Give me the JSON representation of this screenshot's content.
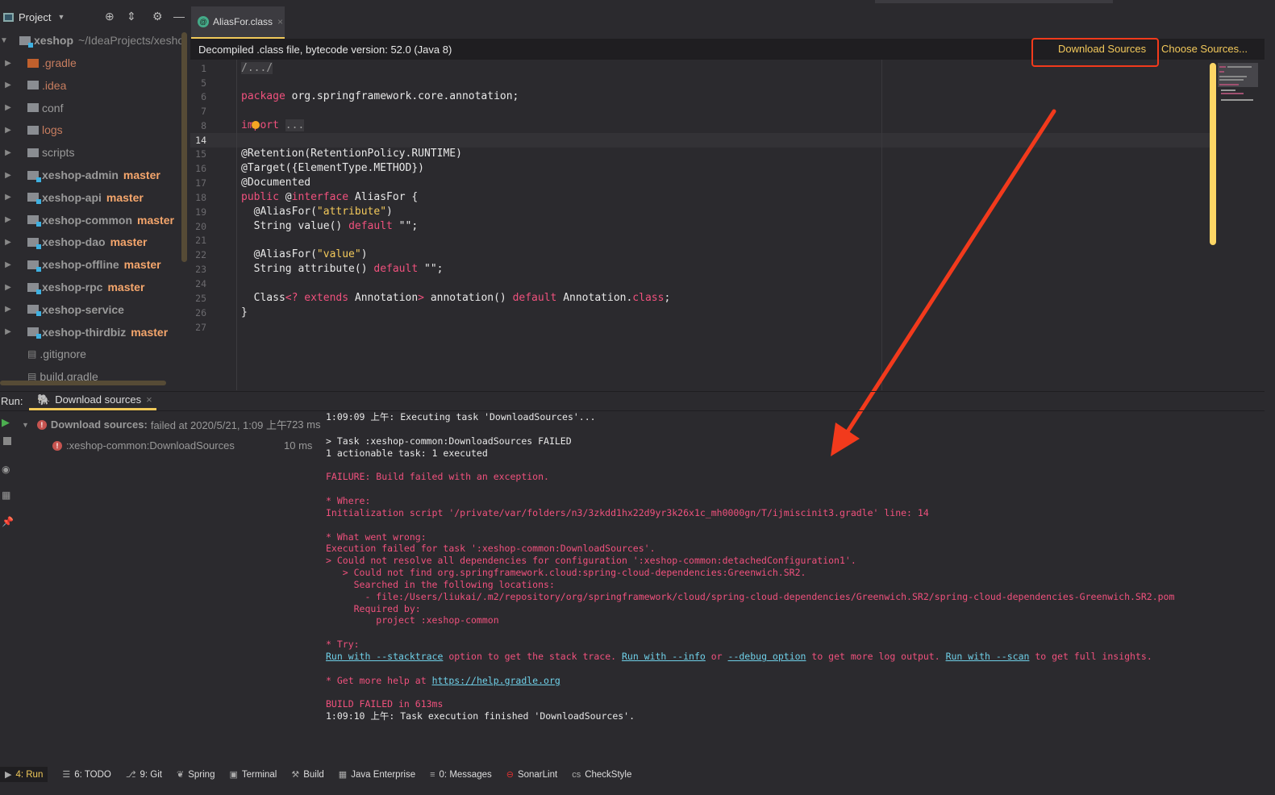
{
  "project_panel": {
    "title": "Project",
    "root": {
      "name": "xeshop",
      "path": "~/IdeaProjects/xesho"
    },
    "items": [
      {
        "name": ".gradle",
        "branch": "",
        "type": "folder-excluded"
      },
      {
        "name": ".idea",
        "branch": "",
        "type": "folder"
      },
      {
        "name": "conf",
        "branch": "",
        "type": "folder"
      },
      {
        "name": "logs",
        "branch": "",
        "type": "folder"
      },
      {
        "name": "scripts",
        "branch": "",
        "type": "folder"
      },
      {
        "name": "xeshop-admin",
        "branch": "master",
        "type": "module"
      },
      {
        "name": "xeshop-api",
        "branch": "master",
        "type": "module"
      },
      {
        "name": "xeshop-common",
        "branch": "master",
        "type": "module"
      },
      {
        "name": "xeshop-dao",
        "branch": "master",
        "type": "module"
      },
      {
        "name": "xeshop-offline",
        "branch": "master",
        "type": "module"
      },
      {
        "name": "xeshop-rpc",
        "branch": "master",
        "type": "module"
      },
      {
        "name": "xeshop-service",
        "branch": "",
        "type": "module"
      },
      {
        "name": "xeshop-thirdbiz",
        "branch": "master",
        "type": "module"
      },
      {
        "name": ".gitignore",
        "branch": "",
        "type": "file"
      },
      {
        "name": "build.gradle",
        "branch": "",
        "type": "file"
      }
    ]
  },
  "editor": {
    "tab": "AliasFor.class",
    "banner": "Decompiled .class file, bytecode version: 52.0 (Java 8)",
    "download_sources": "Download Sources",
    "choose_sources": "Choose Sources...",
    "lines": [
      {
        "n": "1",
        "tokens": [
          {
            "t": "/.../",
            "c": "cm"
          }
        ]
      },
      {
        "n": "5",
        "tokens": []
      },
      {
        "n": "6",
        "tokens": [
          {
            "t": "package",
            "c": "kw"
          },
          {
            "t": " org.springframework.core.annotation;",
            "c": ""
          }
        ]
      },
      {
        "n": "7",
        "tokens": []
      },
      {
        "n": "8",
        "tokens": [
          {
            "t": "import",
            "c": "kw"
          },
          {
            "t": " ",
            "c": ""
          },
          {
            "t": "...",
            "c": "fold"
          }
        ]
      },
      {
        "n": "14",
        "tokens": []
      },
      {
        "n": "15",
        "tokens": [
          {
            "t": "@Retention(RetentionPolicy.RUNTIME)",
            "c": ""
          }
        ]
      },
      {
        "n": "16",
        "tokens": [
          {
            "t": "@Target({ElementType.METHOD})",
            "c": ""
          }
        ]
      },
      {
        "n": "17",
        "tokens": [
          {
            "t": "@Documented",
            "c": ""
          }
        ]
      },
      {
        "n": "18",
        "tokens": [
          {
            "t": "public",
            "c": "kw"
          },
          {
            "t": " @",
            "c": ""
          },
          {
            "t": "interface",
            "c": "kw"
          },
          {
            "t": " AliasFor {",
            "c": ""
          }
        ]
      },
      {
        "n": "19",
        "tokens": [
          {
            "t": "  @AliasFor(",
            "c": ""
          },
          {
            "t": "\"attribute\"",
            "c": "str"
          },
          {
            "t": ")",
            "c": ""
          }
        ]
      },
      {
        "n": "20",
        "tokens": [
          {
            "t": "  String value() ",
            "c": ""
          },
          {
            "t": "default",
            "c": "kw"
          },
          {
            "t": " \"\";",
            "c": ""
          }
        ]
      },
      {
        "n": "21",
        "tokens": []
      },
      {
        "n": "22",
        "tokens": [
          {
            "t": "  @AliasFor(",
            "c": ""
          },
          {
            "t": "\"value\"",
            "c": "str"
          },
          {
            "t": ")",
            "c": ""
          }
        ]
      },
      {
        "n": "23",
        "tokens": [
          {
            "t": "  String attribute() ",
            "c": ""
          },
          {
            "t": "default",
            "c": "kw"
          },
          {
            "t": " \"\";",
            "c": ""
          }
        ]
      },
      {
        "n": "24",
        "tokens": []
      },
      {
        "n": "25",
        "tokens": [
          {
            "t": "  Class",
            "c": ""
          },
          {
            "t": "<? extends",
            "c": "kw"
          },
          {
            "t": " Annotation",
            "c": ""
          },
          {
            "t": ">",
            "c": "kw"
          },
          {
            "t": " annotation() ",
            "c": ""
          },
          {
            "t": "default",
            "c": "kw"
          },
          {
            "t": " Annotation.",
            "c": ""
          },
          {
            "t": "class",
            "c": "kw"
          },
          {
            "t": ";",
            "c": ""
          }
        ]
      },
      {
        "n": "26",
        "tokens": [
          {
            "t": "}",
            "c": ""
          }
        ]
      },
      {
        "n": "27",
        "tokens": []
      }
    ]
  },
  "run_panel": {
    "label": "Run:",
    "tab": "Download sources",
    "tree": [
      {
        "title": "Download sources:",
        "detail": "failed at 2020/5/21, 1:09 上午",
        "time": "723 ms"
      },
      {
        "title": ":xeshop-common:DownloadSources",
        "detail": "",
        "time": "10 ms"
      }
    ],
    "console": [
      [
        {
          "t": "1:09:09 上午: Executing task 'DownloadSources'...",
          "c": "w"
        }
      ],
      [],
      [
        {
          "t": "> Task :xeshop-common:DownloadSources FAILED",
          "c": "w"
        }
      ],
      [
        {
          "t": "1 actionable task: 1 executed",
          "c": "w"
        }
      ],
      [],
      [
        {
          "t": "FAILURE: Build failed with an exception.",
          "c": "r"
        }
      ],
      [],
      [
        {
          "t": "* Where:",
          "c": "r"
        }
      ],
      [
        {
          "t": "Initialization script '/private/var/folders/n3/3zkdd1hx22d9yr3k26x1c_mh0000gn/T/ijmiscinit3.gradle' line: 14",
          "c": "r"
        }
      ],
      [],
      [
        {
          "t": "* What went wrong:",
          "c": "r"
        }
      ],
      [
        {
          "t": "Execution failed for task ':xeshop-common:DownloadSources'.",
          "c": "r"
        }
      ],
      [
        {
          "t": "> Could not resolve all dependencies for configuration ':xeshop-common:detachedConfiguration1'.",
          "c": "r"
        }
      ],
      [
        {
          "t": "   > Could not find org.springframework.cloud:spring-cloud-dependencies:Greenwich.SR2.",
          "c": "r"
        }
      ],
      [
        {
          "t": "     Searched in the following locations:",
          "c": "r"
        }
      ],
      [
        {
          "t": "       - file:/Users/liukai/.m2/repository/org/springframework/cloud/spring-cloud-dependencies/Greenwich.SR2/spring-cloud-dependencies-Greenwich.SR2.pom",
          "c": "r"
        }
      ],
      [
        {
          "t": "     Required by:",
          "c": "r"
        }
      ],
      [
        {
          "t": "         project :xeshop-common",
          "c": "r"
        }
      ],
      [],
      [
        {
          "t": "* Try:",
          "c": "r"
        }
      ],
      [
        {
          "t": "Run with --stacktrace",
          "c": "lk"
        },
        {
          "t": " option to get the stack trace. ",
          "c": "r"
        },
        {
          "t": "Run with --info",
          "c": "lk"
        },
        {
          "t": " or ",
          "c": "r"
        },
        {
          "t": "--debug option",
          "c": "lk"
        },
        {
          "t": " to get more log output. ",
          "c": "r"
        },
        {
          "t": "Run with --scan",
          "c": "lk"
        },
        {
          "t": " to get full insights.",
          "c": "r"
        }
      ],
      [],
      [
        {
          "t": "* Get more help at ",
          "c": "r"
        },
        {
          "t": "https://help.gradle.org",
          "c": "lk"
        }
      ],
      [],
      [
        {
          "t": "BUILD FAILED in 613ms",
          "c": "r"
        }
      ],
      [
        {
          "t": "1:09:10 上午: Task execution finished 'DownloadSources'.",
          "c": "w"
        }
      ]
    ]
  },
  "status_bar": [
    {
      "label": "4: Run",
      "icon": "play-icon",
      "glyph": "▶",
      "active": true
    },
    {
      "label": "6: TODO",
      "icon": "list-icon",
      "glyph": "☰",
      "active": false
    },
    {
      "label": "9: Git",
      "icon": "git-icon",
      "glyph": "⎇",
      "active": false
    },
    {
      "label": "Spring",
      "icon": "spring-leaf-icon",
      "glyph": "❦",
      "active": false
    },
    {
      "label": "Terminal",
      "icon": "terminal-icon",
      "glyph": "▣",
      "active": false
    },
    {
      "label": "Build",
      "icon": "hammer-icon",
      "glyph": "⚒",
      "active": false
    },
    {
      "label": "Java Enterprise",
      "icon": "java-enterprise-icon",
      "glyph": "▦",
      "active": false
    },
    {
      "label": "0: Messages",
      "icon": "messages-icon",
      "glyph": "≡",
      "active": false
    },
    {
      "label": "SonarLint",
      "icon": "sonarlint-icon",
      "glyph": "⊖",
      "active": false
    },
    {
      "label": "CheckStyle",
      "icon": "checkstyle-icon",
      "glyph": "cs",
      "active": false
    }
  ],
  "colors": {
    "accent": "#f0c95a",
    "annotation_red": "#f23a1c",
    "keyword": "#f0517d",
    "string": "#f3c95b",
    "link": "#6fd0e8"
  }
}
